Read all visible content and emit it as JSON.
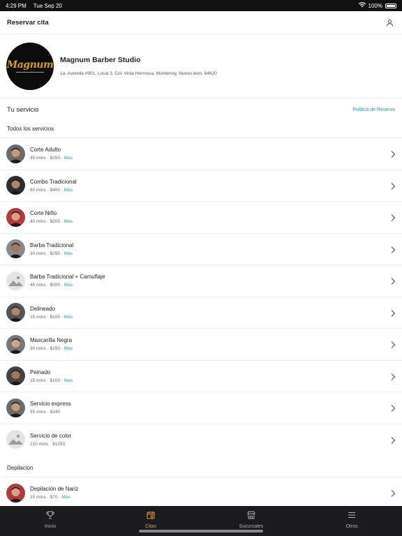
{
  "status_bar": {
    "time": "4:29 PM",
    "date": "Tue Sep 20",
    "battery": "100%"
  },
  "header": {
    "title": "Reservar cita"
  },
  "shop": {
    "logo_text": "Magnum",
    "name": "Magnum Barber Studio",
    "address": "1a. Avenida #901, Local 3. Col. Vista Hermosa, Monterrey, Nuevo leon, 64620"
  },
  "section": {
    "title": "Tu servicio",
    "policy_link": "Política de Reserva"
  },
  "groups": [
    {
      "label": "Todos los servicios",
      "items": [
        {
          "name": "Corte Adulto",
          "duration": "35 mins",
          "price": "$250",
          "more": "Mas"
        },
        {
          "name": "Combo Tradicional",
          "duration": "60 mins",
          "price": "$400",
          "more": "Mas"
        },
        {
          "name": "Corte Niño",
          "duration": "40 mins",
          "price": "$200",
          "more": "Mas"
        },
        {
          "name": "Barba Tradicional",
          "duration": "30 mins",
          "price": "$250",
          "more": "Mas"
        },
        {
          "name": "Barba Tradicional + Camuflaje",
          "duration": "45 mins",
          "price": "$500",
          "more": "Mas"
        },
        {
          "name": "Delineado",
          "duration": "15 mins",
          "price": "$100",
          "more": "Mas"
        },
        {
          "name": "Mascarilla Negra",
          "duration": "30 mins",
          "price": "$150",
          "more": "Mas"
        },
        {
          "name": "Peinado",
          "duration": "15 mins",
          "price": "$100",
          "more": "Mas"
        },
        {
          "name": "Servicio express",
          "duration": "55 mins",
          "price": "$340",
          "more": ""
        },
        {
          "name": "Servicio de color",
          "duration": "210 mins",
          "price": "$1250",
          "more": ""
        }
      ]
    },
    {
      "label": "Depilación",
      "items": [
        {
          "name": "Depilación de Nariz",
          "duration": "15 mins",
          "price": "$70",
          "more": "Mas"
        }
      ]
    }
  ],
  "tabs": [
    {
      "label": "Inicio",
      "icon": "trophy-icon",
      "active": false
    },
    {
      "label": "Citas",
      "icon": "calendar-icon",
      "active": true
    },
    {
      "label": "Sucursales",
      "icon": "store-icon",
      "active": false
    },
    {
      "label": "Otros",
      "icon": "menu-icon",
      "active": false
    }
  ],
  "colors": {
    "accent": "#2a8fd6",
    "active_tab": "#e0a33b",
    "tabbar_bg": "#1c1c1e"
  },
  "avatar_styles": [
    "photo",
    "photo",
    "photo",
    "photo",
    "placeholder",
    "photo",
    "photo",
    "photo",
    "photo",
    "placeholder",
    "photo"
  ]
}
